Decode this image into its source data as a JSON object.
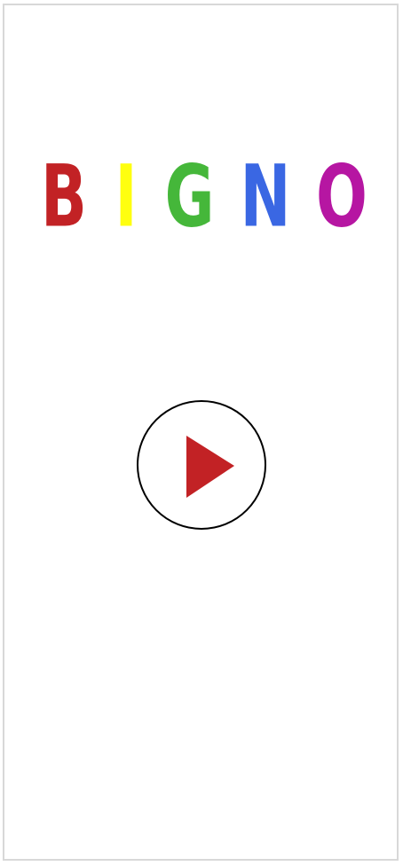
{
  "title": {
    "letters": [
      {
        "char": "B",
        "color": "#c22225"
      },
      {
        "char": "I",
        "color": "#ffff0f"
      },
      {
        "char": "G",
        "color": "#45b73a"
      },
      {
        "char": "N",
        "color": "#3a67e3"
      },
      {
        "char": "O",
        "color": "#b616a2"
      }
    ]
  },
  "play_button": {
    "icon": "play-icon",
    "icon_color": "#c22225",
    "border_color": "#000000"
  }
}
